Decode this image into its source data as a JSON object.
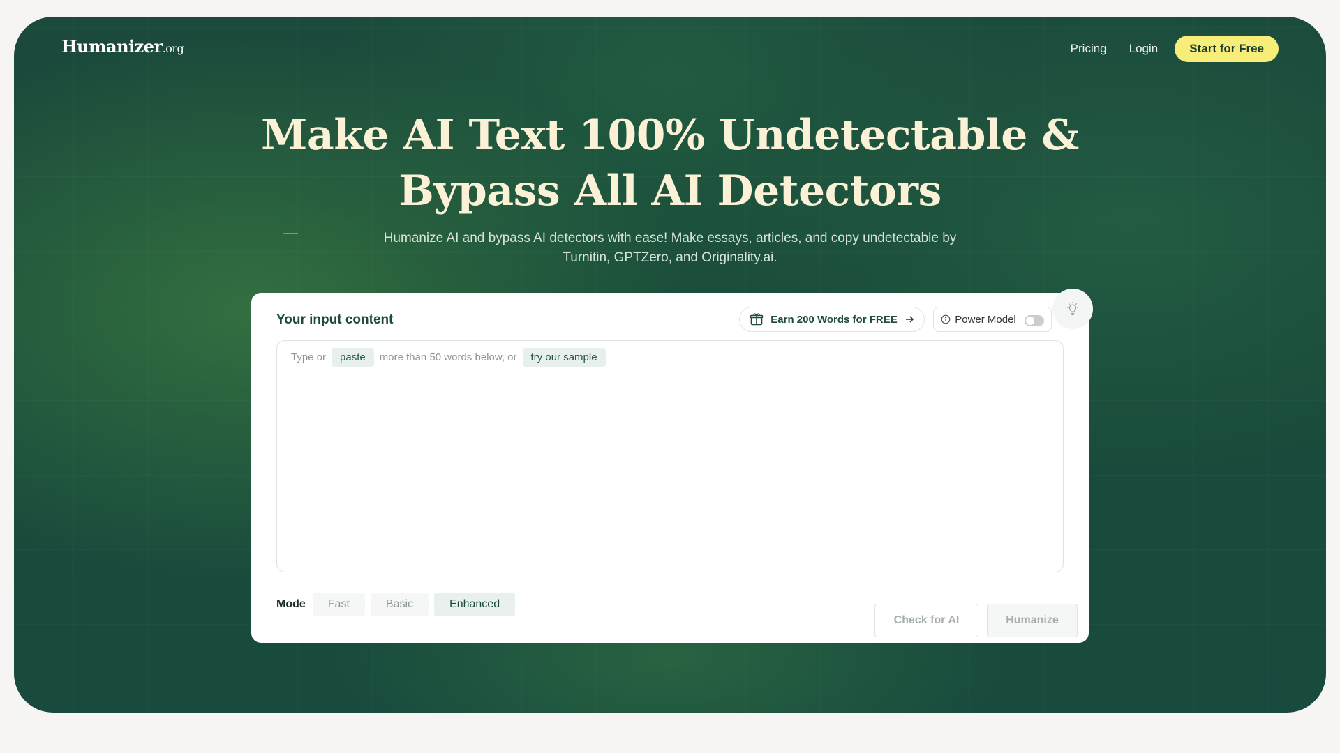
{
  "brand": {
    "name": "Humanizer",
    "tld": ".org"
  },
  "nav": {
    "pricing": "Pricing",
    "login": "Login",
    "cta": "Start for Free"
  },
  "hero": {
    "title_line1": "Make AI Text 100% Undetectable &",
    "title_line2": "Bypass All AI Detectors",
    "subtitle_line1": "Humanize AI and bypass AI detectors with ease! Make essays, articles, and copy undetectable by",
    "subtitle_line2": "Turnitin, GPTZero, and Originality.ai."
  },
  "card": {
    "title": "Your input content",
    "earn_label": "Earn 200 Words for FREE",
    "power_label": "Power Model",
    "power_enabled": false,
    "hint": {
      "prefix": "Type or",
      "paste_chip": "paste",
      "middle": "more than 50 words below, or",
      "sample_chip": "try our sample"
    },
    "mode": {
      "label": "Mode",
      "options": [
        "Fast",
        "Basic",
        "Enhanced"
      ],
      "selected": "Enhanced"
    },
    "check_button": "Check for AI",
    "humanize_button": "Humanize"
  },
  "icons": {
    "gift": "gift-icon",
    "arrow": "arrow-right-icon",
    "info": "info-icon",
    "bulb": "lightbulb-icon"
  },
  "colors": {
    "hero_bg": "#1a4c3a",
    "title": "#faf1d6",
    "cta_bg": "#f7ee7a",
    "brand_text": "#1d4a3c"
  }
}
